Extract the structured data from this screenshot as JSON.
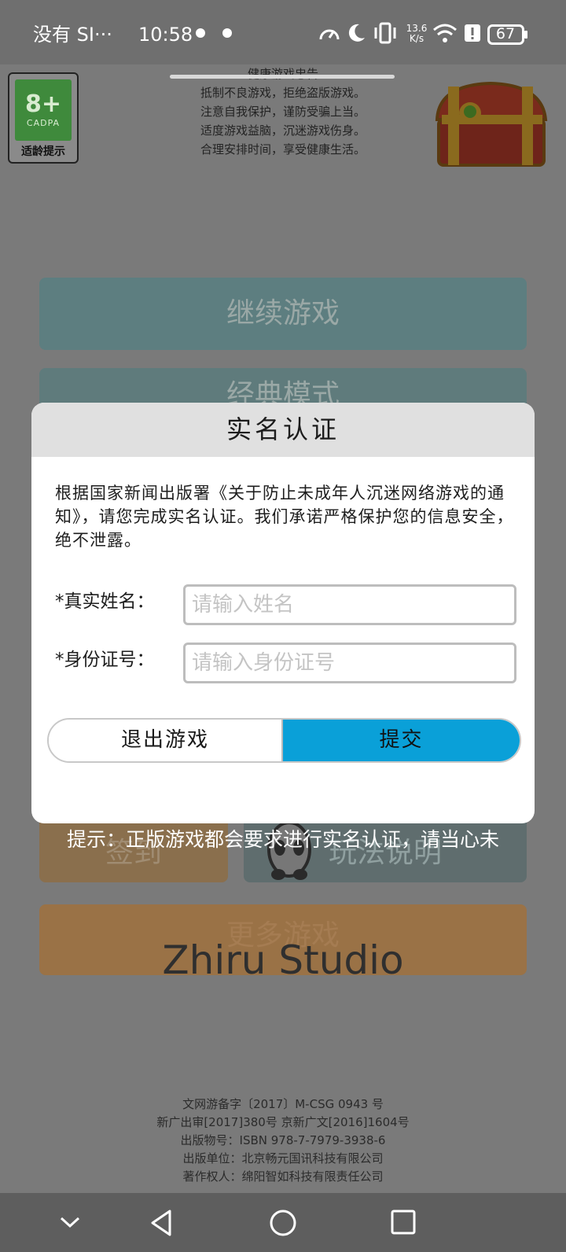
{
  "status_bar": {
    "carrier": "没有 SI···",
    "time": "10:58",
    "net_speed": "13.6 K/s",
    "battery": "67",
    "icons": [
      "weather-icon",
      "weather-icon",
      "speed-icon",
      "moon-icon",
      "vibrate-icon",
      "wifi-icon",
      "alert-icon",
      "battery-icon"
    ]
  },
  "age_badge": {
    "rating": "8+",
    "org": "CADPA",
    "hint": "适龄提示"
  },
  "health_notice": {
    "title": "健康游戏忠告",
    "lines": [
      "抵制不良游戏，拒绝盗版游戏。",
      "注意自我保护，谨防受骗上当。",
      "适度游戏益脑，沉迷游戏伤身。",
      "合理安排时间，享受健康生活。"
    ]
  },
  "menu": {
    "continue": "继续游戏",
    "classic": "经典模式",
    "signin": "签到",
    "rules": "玩法说明",
    "more": "更多游戏"
  },
  "studio": "Zhiru Studio",
  "marquee": "提示：正版游戏都会要求进行实名认证，请当心未",
  "footer": {
    "lines": [
      "文网游备字〔2017〕M-CSG 0943 号",
      "新广出审[2017]380号 京新广文[2016]1604号",
      "出版物号：ISBN 978-7-7979-3938-6",
      "出版单位：北京畅元国讯科技有限公司",
      "著作权人：绵阳智如科技有限责任公司"
    ]
  },
  "dialog": {
    "title": "实名认证",
    "description": "根据国家新闻出版署《关于防止未成年人沉迷网络游戏的通知》，请您完成实名认证。我们承诺严格保护您的信息安全，绝不泄露。",
    "name_label": "*真实姓名：",
    "name_placeholder": "请输入姓名",
    "name_value": "",
    "id_label": "*身份证号：",
    "id_placeholder": "请输入身份证号",
    "id_value": "",
    "exit_button": "退出游戏",
    "submit_button": "提交"
  },
  "colors": {
    "submit_bg": "#0aa0d8",
    "header_bg": "#e0e0e0",
    "overlay": "#6e6e6e"
  }
}
